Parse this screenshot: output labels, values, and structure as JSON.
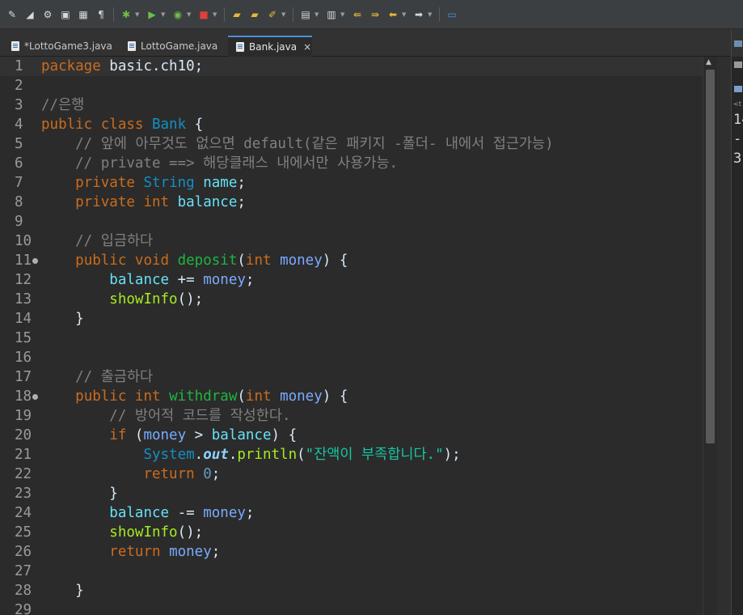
{
  "tabs": [
    {
      "label": "*LottoGame3.java",
      "active": false
    },
    {
      "label": "LottoGame.java",
      "active": false
    },
    {
      "label": "Bank.java",
      "active": true
    }
  ],
  "tab_close": "×",
  "toolbar_icons": [
    "properties-icon",
    "toggle-mark-icon",
    "settings-icon",
    "save-all-icon",
    "show-whitespace-icon",
    "pilcrow-icon",
    "debug-icon",
    "run-icon",
    "run-last-icon",
    "stop-icon",
    "open-folder-icon",
    "open-type-icon",
    "pen-icon",
    "annotation-icon",
    "next-annotation-icon",
    "back-icon",
    "forward-icon",
    "left-arrow-icon",
    "right-arrow-icon",
    "new-window-icon"
  ],
  "editor": {
    "lines": [
      {
        "n": "1",
        "parts": [
          {
            "c": "kw",
            "t": "package"
          },
          {
            "c": "",
            "t": " basic.ch10;"
          }
        ]
      },
      {
        "n": "2",
        "parts": []
      },
      {
        "n": "3",
        "parts": [
          {
            "c": "cm",
            "t": "//은행"
          }
        ]
      },
      {
        "n": "4",
        "parts": [
          {
            "c": "kw",
            "t": "public class"
          },
          {
            "c": "",
            "t": " "
          },
          {
            "c": "ty",
            "t": "Bank"
          },
          {
            "c": "",
            "t": " {"
          }
        ]
      },
      {
        "n": "5",
        "parts": [
          {
            "c": "cm",
            "t": "    // 앞에 아무것도 없으면 default(같은 패키지 -폴더- 내에서 접근가능)"
          }
        ]
      },
      {
        "n": "6",
        "parts": [
          {
            "c": "cm",
            "t": "    // private ==> 해당클래스 내에서만 사용가능."
          }
        ]
      },
      {
        "n": "7",
        "parts": [
          {
            "c": "",
            "t": "    "
          },
          {
            "c": "kw",
            "t": "private"
          },
          {
            "c": "",
            "t": " "
          },
          {
            "c": "ty",
            "t": "String"
          },
          {
            "c": "",
            "t": " "
          },
          {
            "c": "fld",
            "t": "name"
          },
          {
            "c": "",
            "t": ";"
          }
        ]
      },
      {
        "n": "8",
        "parts": [
          {
            "c": "",
            "t": "    "
          },
          {
            "c": "kw",
            "t": "private int"
          },
          {
            "c": "",
            "t": " "
          },
          {
            "c": "fld",
            "t": "balance"
          },
          {
            "c": "",
            "t": ";"
          }
        ]
      },
      {
        "n": "9",
        "parts": []
      },
      {
        "n": "10",
        "parts": [
          {
            "c": "cm",
            "t": "    // 입금하다"
          }
        ]
      },
      {
        "n": "11",
        "fold": true,
        "parts": [
          {
            "c": "",
            "t": "    "
          },
          {
            "c": "kw",
            "t": "public void"
          },
          {
            "c": "",
            "t": " "
          },
          {
            "c": "mth",
            "t": "deposit"
          },
          {
            "c": "",
            "t": "("
          },
          {
            "c": "kw",
            "t": "int"
          },
          {
            "c": "",
            "t": " "
          },
          {
            "c": "prm",
            "t": "money"
          },
          {
            "c": "",
            "t": ") {"
          }
        ]
      },
      {
        "n": "12",
        "parts": [
          {
            "c": "",
            "t": "        "
          },
          {
            "c": "fld",
            "t": "balance"
          },
          {
            "c": "",
            "t": " += "
          },
          {
            "c": "prm",
            "t": "money"
          },
          {
            "c": "",
            "t": ";"
          }
        ]
      },
      {
        "n": "13",
        "parts": [
          {
            "c": "",
            "t": "        "
          },
          {
            "c": "call",
            "t": "showInfo"
          },
          {
            "c": "",
            "t": "();"
          }
        ]
      },
      {
        "n": "14",
        "parts": [
          {
            "c": "",
            "t": "    }"
          }
        ]
      },
      {
        "n": "15",
        "parts": []
      },
      {
        "n": "16",
        "parts": []
      },
      {
        "n": "17",
        "parts": [
          {
            "c": "cm",
            "t": "    // 출금하다"
          }
        ]
      },
      {
        "n": "18",
        "fold": true,
        "parts": [
          {
            "c": "",
            "t": "    "
          },
          {
            "c": "kw",
            "t": "public int"
          },
          {
            "c": "",
            "t": " "
          },
          {
            "c": "mth",
            "t": "withdraw"
          },
          {
            "c": "",
            "t": "("
          },
          {
            "c": "kw",
            "t": "int"
          },
          {
            "c": "",
            "t": " "
          },
          {
            "c": "prm",
            "t": "money"
          },
          {
            "c": "",
            "t": ") {"
          }
        ]
      },
      {
        "n": "19",
        "parts": [
          {
            "c": "cm",
            "t": "        // 방어적 코드를 작성한다."
          }
        ]
      },
      {
        "n": "20",
        "parts": [
          {
            "c": "",
            "t": "        "
          },
          {
            "c": "kw",
            "t": "if"
          },
          {
            "c": "",
            "t": " ("
          },
          {
            "c": "prm",
            "t": "money"
          },
          {
            "c": "",
            "t": " > "
          },
          {
            "c": "fld",
            "t": "balance"
          },
          {
            "c": "",
            "t": ") {"
          }
        ]
      },
      {
        "n": "21",
        "parts": [
          {
            "c": "",
            "t": "            "
          },
          {
            "c": "sys",
            "t": "System"
          },
          {
            "c": "",
            "t": "."
          },
          {
            "c": "static",
            "t": "out"
          },
          {
            "c": "",
            "t": "."
          },
          {
            "c": "call",
            "t": "println"
          },
          {
            "c": "",
            "t": "("
          },
          {
            "c": "st",
            "t": "\"잔액이 부족합니다.\""
          },
          {
            "c": "",
            "t": ");"
          }
        ]
      },
      {
        "n": "22",
        "parts": [
          {
            "c": "",
            "t": "            "
          },
          {
            "c": "kw",
            "t": "return"
          },
          {
            "c": "",
            "t": " "
          },
          {
            "c": "num",
            "t": "0"
          },
          {
            "c": "",
            "t": ";"
          }
        ]
      },
      {
        "n": "23",
        "parts": [
          {
            "c": "",
            "t": "        }"
          }
        ]
      },
      {
        "n": "24",
        "parts": [
          {
            "c": "",
            "t": "        "
          },
          {
            "c": "fld",
            "t": "balance"
          },
          {
            "c": "",
            "t": " -= "
          },
          {
            "c": "prm",
            "t": "money"
          },
          {
            "c": "",
            "t": ";"
          }
        ]
      },
      {
        "n": "25",
        "parts": [
          {
            "c": "",
            "t": "        "
          },
          {
            "c": "call",
            "t": "showInfo"
          },
          {
            "c": "",
            "t": "();"
          }
        ]
      },
      {
        "n": "26",
        "parts": [
          {
            "c": "",
            "t": "        "
          },
          {
            "c": "kw",
            "t": "return"
          },
          {
            "c": "",
            "t": " "
          },
          {
            "c": "prm",
            "t": "money"
          },
          {
            "c": "",
            "t": ";"
          }
        ]
      },
      {
        "n": "27",
        "parts": []
      },
      {
        "n": "28",
        "parts": [
          {
            "c": "",
            "t": "    }"
          }
        ]
      },
      {
        "n": "29",
        "parts": []
      }
    ]
  },
  "side_panel": {
    "small_label": "<t",
    "console_lines": [
      "14",
      "--",
      "3"
    ]
  }
}
